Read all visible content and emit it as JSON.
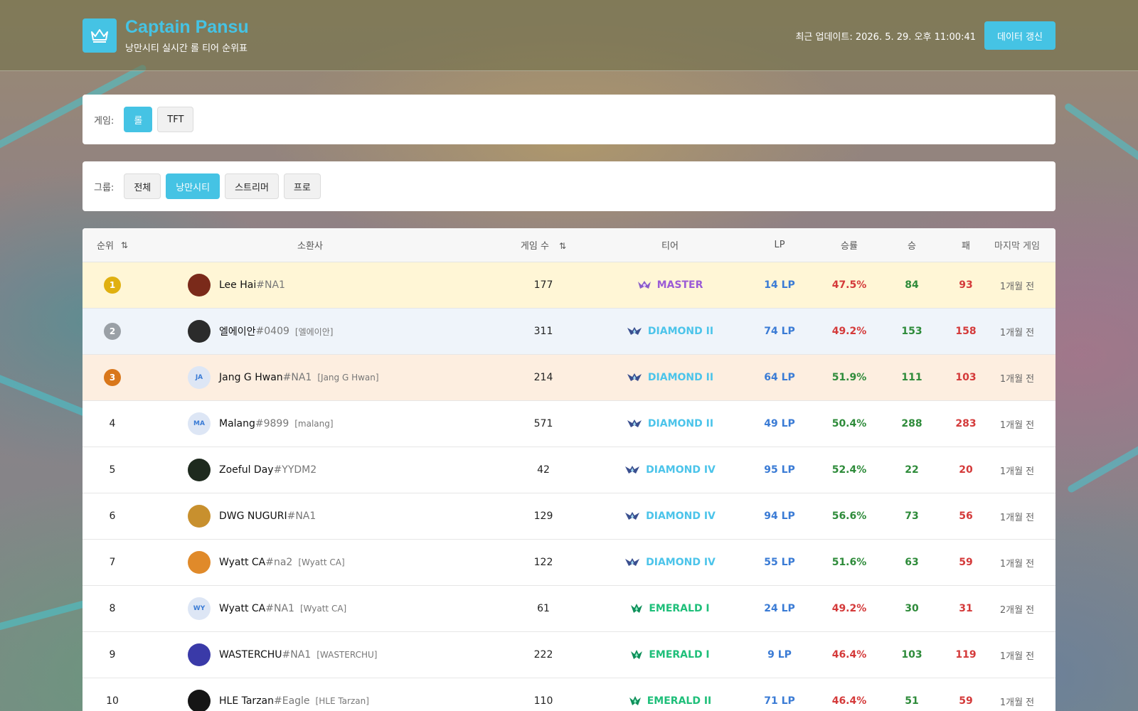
{
  "header": {
    "title": "Captain Pansu",
    "subtitle": "낭만시티 실시간 롤 티어 순위표",
    "update_label": "최근 업데이트: 2026. 5. 29. 오후 11:00:41",
    "refresh_label": "데이터 갱신",
    "accent": "#45c3e4"
  },
  "game_filter": {
    "label": "게임:",
    "options": [
      {
        "label": "롤",
        "active": true
      },
      {
        "label": "TFT",
        "active": false
      }
    ]
  },
  "group_filter": {
    "label": "그룹:",
    "options": [
      {
        "label": "전체",
        "active": false
      },
      {
        "label": "낭만시티",
        "active": true
      },
      {
        "label": "스트리머",
        "active": false
      },
      {
        "label": "프로",
        "active": false
      }
    ]
  },
  "table": {
    "columns": {
      "rank": "순위",
      "summoner": "소환사",
      "games": "게임 수",
      "tier": "티어",
      "lp": "LP",
      "winrate": "승률",
      "wins": "승",
      "losses": "패",
      "last_game": "마지막 게임"
    },
    "rows": [
      {
        "rank": "1",
        "avatar": "",
        "avatar_color": "#7a2a1a",
        "name": "Lee Hai",
        "tag": "#NA1",
        "alias": "",
        "games": "177",
        "tier": "MASTER",
        "tier_color": "#9b5bd6",
        "tier_icon": "master-icon",
        "lp": "14 LP",
        "winrate": "47.5%",
        "winrate_color": "#d43a3a",
        "wins": "84",
        "losses": "93",
        "last": "1개월 전"
      },
      {
        "rank": "2",
        "avatar": "",
        "avatar_color": "#2b2b2b",
        "name": "엘에이안",
        "tag": "#0409",
        "alias": "[엘에이안]",
        "games": "311",
        "tier": "DIAMOND II",
        "tier_color": "#4cc4ea",
        "tier_icon": "diamond-icon",
        "lp": "74 LP",
        "winrate": "49.2%",
        "winrate_color": "#d43a3a",
        "wins": "153",
        "losses": "158",
        "last": "1개월 전"
      },
      {
        "rank": "3",
        "avatar": "JA",
        "avatar_color": "#dde6f5",
        "name": "Jang G Hwan",
        "tag": "#NA1",
        "alias": "[Jang G Hwan]",
        "games": "214",
        "tier": "DIAMOND II",
        "tier_color": "#4cc4ea",
        "tier_icon": "diamond-icon",
        "lp": "64 LP",
        "winrate": "51.9%",
        "winrate_color": "#2e8b3a",
        "wins": "111",
        "losses": "103",
        "last": "1개월 전"
      },
      {
        "rank": "4",
        "avatar": "MA",
        "avatar_color": "#dde6f5",
        "name": "Malang",
        "tag": "#9899",
        "alias": "[malang]",
        "games": "571",
        "tier": "DIAMOND II",
        "tier_color": "#4cc4ea",
        "tier_icon": "diamond-icon",
        "lp": "49 LP",
        "winrate": "50.4%",
        "winrate_color": "#2e8b3a",
        "wins": "288",
        "losses": "283",
        "last": "1개월 전"
      },
      {
        "rank": "5",
        "avatar": "",
        "avatar_color": "#1e2a1e",
        "name": "Zoeful Day",
        "tag": "#YYDM2",
        "alias": "",
        "games": "42",
        "tier": "DIAMOND IV",
        "tier_color": "#4cc4ea",
        "tier_icon": "diamond-icon",
        "lp": "95 LP",
        "winrate": "52.4%",
        "winrate_color": "#2e8b3a",
        "wins": "22",
        "losses": "20",
        "last": "1개월 전"
      },
      {
        "rank": "6",
        "avatar": "",
        "avatar_color": "#c8902e",
        "name": "DWG NUGURI",
        "tag": "#NA1",
        "alias": "",
        "games": "129",
        "tier": "DIAMOND IV",
        "tier_color": "#4cc4ea",
        "tier_icon": "diamond-icon",
        "lp": "94 LP",
        "winrate": "56.6%",
        "winrate_color": "#2e8b3a",
        "wins": "73",
        "losses": "56",
        "last": "1개월 전"
      },
      {
        "rank": "7",
        "avatar": "",
        "avatar_color": "#e08a2a",
        "name": "Wyatt CA",
        "tag": "#na2",
        "alias": "[Wyatt CA]",
        "games": "122",
        "tier": "DIAMOND IV",
        "tier_color": "#4cc4ea",
        "tier_icon": "diamond-icon",
        "lp": "55 LP",
        "winrate": "51.6%",
        "winrate_color": "#2e8b3a",
        "wins": "63",
        "losses": "59",
        "last": "1개월 전"
      },
      {
        "rank": "8",
        "avatar": "WY",
        "avatar_color": "#dde6f5",
        "name": "Wyatt CA",
        "tag": "#NA1",
        "alias": "[Wyatt CA]",
        "games": "61",
        "tier": "EMERALD I",
        "tier_color": "#1fbf7a",
        "tier_icon": "emerald-icon",
        "lp": "24 LP",
        "winrate": "49.2%",
        "winrate_color": "#d43a3a",
        "wins": "30",
        "losses": "31",
        "last": "2개월 전"
      },
      {
        "rank": "9",
        "avatar": "",
        "avatar_color": "#3a3aa8",
        "name": "WASTERCHU",
        "tag": "#NA1",
        "alias": "[WASTERCHU]",
        "games": "222",
        "tier": "EMERALD I",
        "tier_color": "#1fbf7a",
        "tier_icon": "emerald-icon",
        "lp": "9 LP",
        "winrate": "46.4%",
        "winrate_color": "#d43a3a",
        "wins": "103",
        "losses": "119",
        "last": "1개월 전"
      },
      {
        "rank": "10",
        "avatar": "",
        "avatar_color": "#151515",
        "name": "HLE Tarzan",
        "tag": "#Eagle",
        "alias": "[HLE Tarzan]",
        "games": "110",
        "tier": "EMERALD II",
        "tier_color": "#1fbf7a",
        "tier_icon": "emerald-icon",
        "lp": "71 LP",
        "winrate": "46.4%",
        "winrate_color": "#d43a3a",
        "wins": "51",
        "losses": "59",
        "last": "1개월 전"
      }
    ]
  }
}
